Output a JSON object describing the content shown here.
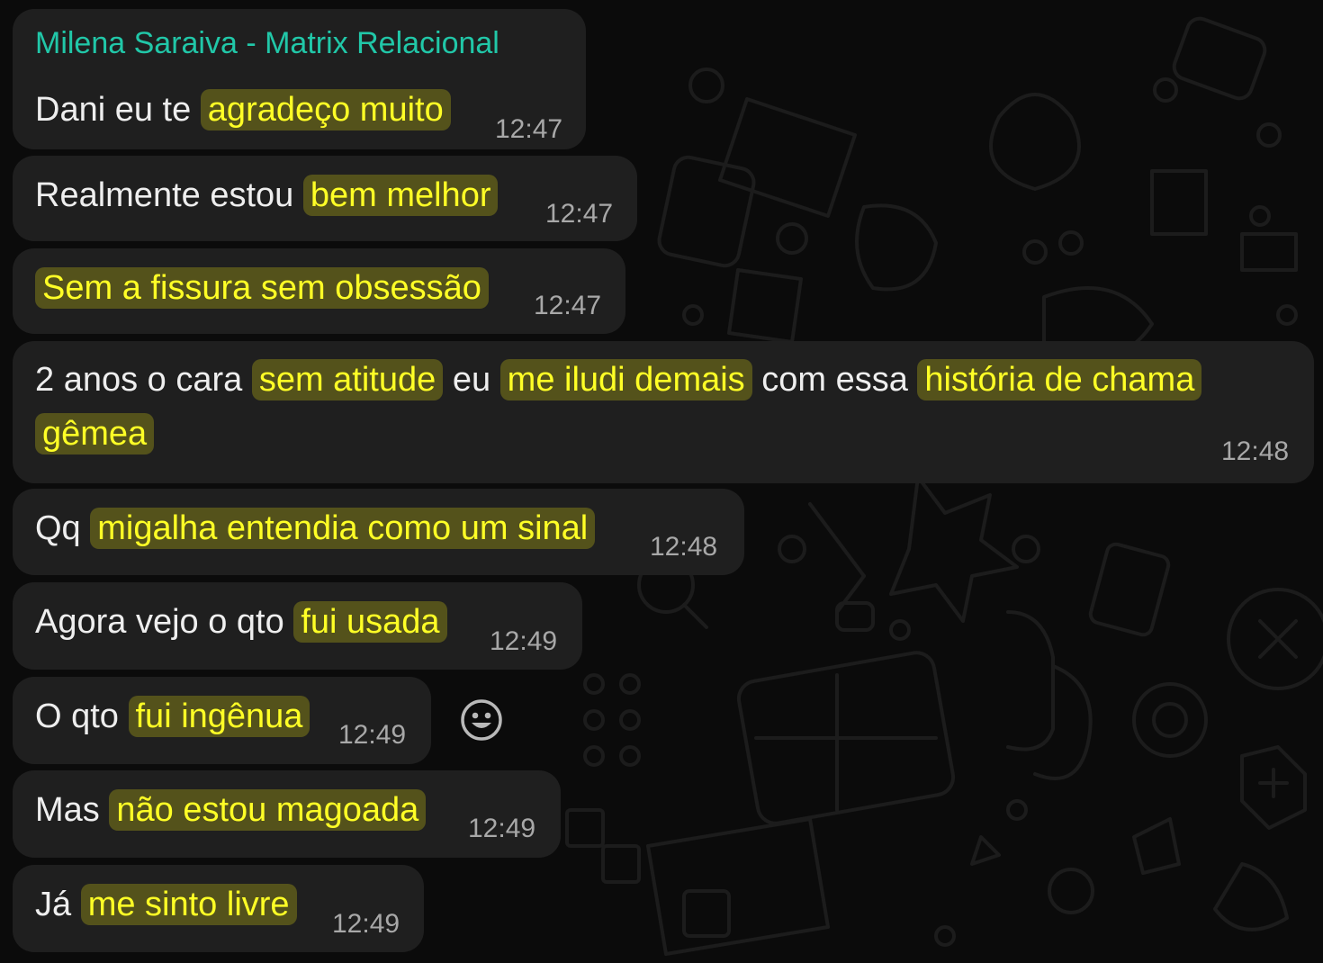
{
  "sender_name": "Milena Saraiva - Matrix Relacional",
  "messages": [
    {
      "parts": [
        {
          "text": "Dani eu te ",
          "highlight": false
        },
        {
          "text": "agradeço muito",
          "highlight": true
        }
      ],
      "time": "12:47"
    },
    {
      "parts": [
        {
          "text": "Realmente estou ",
          "highlight": false
        },
        {
          "text": "bem melhor",
          "highlight": true
        }
      ],
      "time": "12:47"
    },
    {
      "parts": [
        {
          "text": "Sem a fissura sem obsessão",
          "highlight": true
        }
      ],
      "time": "12:47"
    },
    {
      "line1": [
        {
          "text": "2 anos o cara ",
          "highlight": false
        },
        {
          "text": "sem atitude",
          "highlight": true
        },
        {
          "text": " eu ",
          "highlight": false
        },
        {
          "text": "me iludi demais",
          "highlight": true
        },
        {
          "text": " com essa ",
          "highlight": false
        },
        {
          "text": "história de chama",
          "highlight": true
        }
      ],
      "line2": [
        {
          "text": "gêmea",
          "highlight": true
        }
      ],
      "time": "12:48"
    },
    {
      "parts": [
        {
          "text": "Qq ",
          "highlight": false
        },
        {
          "text": "migalha entendia como um sinal",
          "highlight": true
        }
      ],
      "time": "12:48"
    },
    {
      "parts": [
        {
          "text": "Agora vejo o qto ",
          "highlight": false
        },
        {
          "text": "fui usada",
          "highlight": true
        }
      ],
      "time": "12:49"
    },
    {
      "parts": [
        {
          "text": "O qto ",
          "highlight": false
        },
        {
          "text": "fui ingênua",
          "highlight": true
        }
      ],
      "time": "12:49"
    },
    {
      "parts": [
        {
          "text": "Mas ",
          "highlight": false
        },
        {
          "text": "não estou magoada",
          "highlight": true
        }
      ],
      "time": "12:49"
    },
    {
      "parts": [
        {
          "text": "Já ",
          "highlight": false
        },
        {
          "text": "me sinto livre",
          "highlight": true
        }
      ],
      "time": "12:49"
    }
  ],
  "reaction_icon": "smiley-face-icon",
  "colors": {
    "background": "#0b0b0b",
    "bubble": "#1f1f1f",
    "sender": "#21c7a8",
    "text": "#eeeeee",
    "highlight_text": "#ffff26",
    "time": "#a8a8a8"
  }
}
